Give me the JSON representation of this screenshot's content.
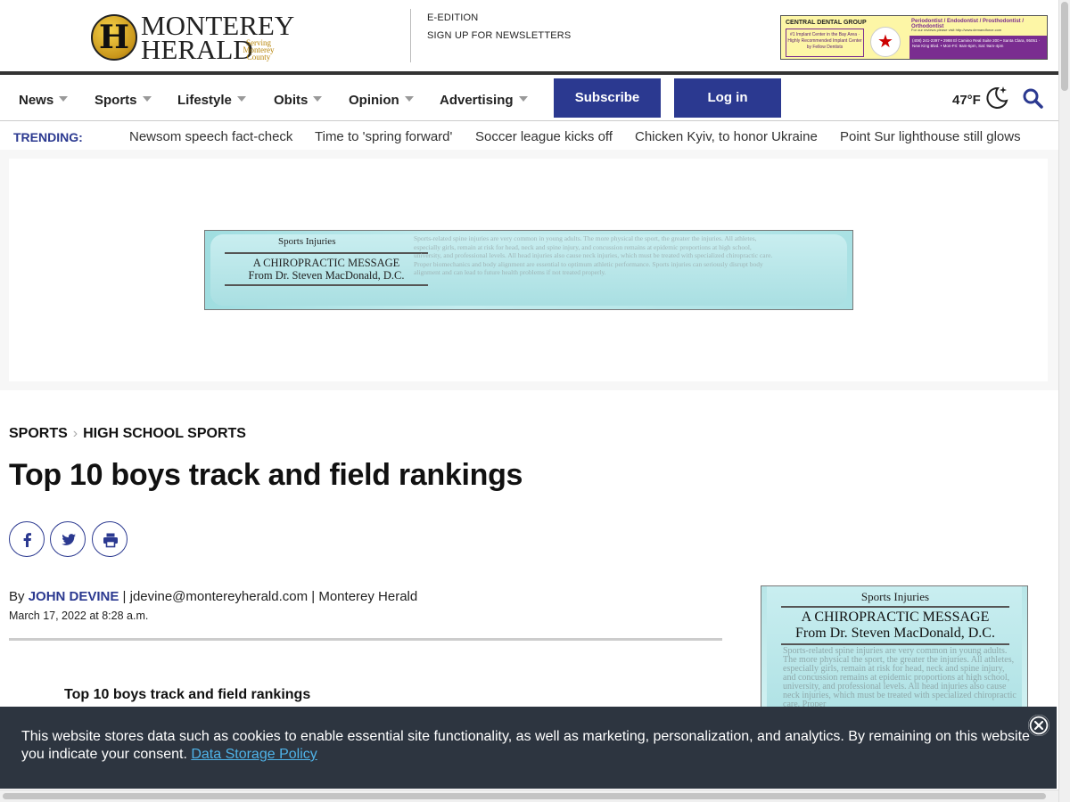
{
  "header": {
    "logo": {
      "word1": "MONTEREY",
      "word2": "HERALD",
      "tagline": "Serving Monterey County",
      "badge_letter": "H"
    },
    "links": [
      "E-EDITION",
      "SIGN UP FOR NEWSLETTERS"
    ],
    "top_ad": {
      "name": "CENTRAL DENTAL GROUP",
      "left_text": "#1 Implant Center in the Bay Area · Highly Recommended Implant Center by Fellow Dentists",
      "badge": "BEST",
      "title": "Periodontist / Endodontist / Prosthodontist / Orthodontist",
      "sub": "For our reviews please visit http://www.demandforce.com",
      "contact": "(408) 241-2397 • 2988 El Camino Real Suite 200 • Santa Clara, 95051 · New King Blvd. • Mon-Fri: 9am-6pm, Sat: 9am-4pm"
    }
  },
  "nav": {
    "items": [
      "News",
      "Sports",
      "Lifestyle",
      "Obits",
      "Opinion",
      "Advertising"
    ],
    "subscribe_label": "Subscribe",
    "login_label": "Log in",
    "weather": "47°F"
  },
  "trending": {
    "label": "TRENDING:",
    "items": [
      "Newsom speech fact-check",
      "Time to 'spring forward'",
      "Soccer league kicks off",
      "Chicken Kyiv, to honor Ukraine",
      "Point Sur lighthouse still glows"
    ]
  },
  "banner_ad": {
    "heading": "Sports Injuries",
    "title_line1": "A CHIROPRACTIC MESSAGE",
    "title_line2": "From Dr. Steven MacDonald, D.C.",
    "body": "Sports-related spine injuries are very common in young adults. The more physical the sport, the greater the injuries. All athletes, especially girls, remain at risk for head, neck and spine injury, and concussion remains at epidemic proportions at high school, university, and professional levels. All head injuries also cause neck injuries, which must be treated with specialized chiropractic care. Proper biomechanics and body alignment are essential to optimum athletic performance. Sports injuries can seriously disrupt body alignment and can lead to future health problems if not treated properly."
  },
  "article": {
    "breadcrumb": [
      "SPORTS",
      "HIGH SCHOOL SPORTS"
    ],
    "headline": "Top 10 boys track and field rankings",
    "byline_prefix": "By",
    "author": "JOHN DEVINE",
    "byline_rest": " | jdevine@montereyherald.com | Monterey Herald",
    "date": "March 17, 2022 at 8:28 a.m.",
    "subheading": "Top 10 boys track and field rankings"
  },
  "side_ad": {
    "heading": "Sports Injuries",
    "title_line1": "A CHIROPRACTIC MESSAGE",
    "title_line2": "From Dr. Steven MacDonald, D.C.",
    "body": "Sports-related spine injuries are very common in young adults. The more physical the sport, the greater the injuries. All athletes, especially girls, remain at risk for head, neck and spine injury, and concussion remains at epidemic proportions at high school, university, and professional levels. All head injuries also cause neck injuries, which must be treated with specialized chiropractic care. Proper"
  },
  "cookie": {
    "text": "This website stores data such as cookies to enable essential site functionality, as well as marketing, personalization, and analytics. By remaining on this website you indicate your consent. ",
    "link": "Data Storage Policy"
  },
  "icons": [
    "moon-stars-icon",
    "search-icon",
    "facebook-icon",
    "twitter-icon",
    "print-icon",
    "close-icon",
    "chevron-right-icon"
  ],
  "colors": {
    "brand_blue": "#2b3990",
    "cookie_bg": "#2d3540",
    "cookie_link": "#4fb3e8",
    "nav_rule": "#333333"
  }
}
